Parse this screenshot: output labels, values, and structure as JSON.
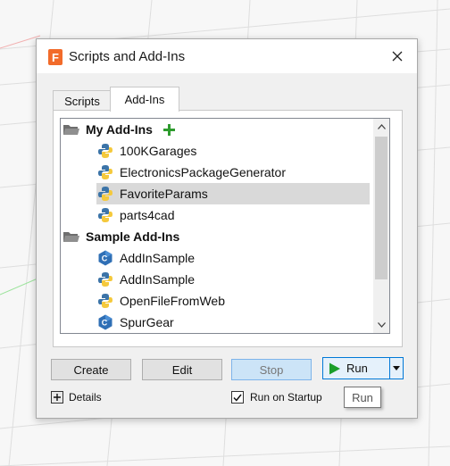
{
  "window": {
    "title": "Scripts and Add-Ins",
    "app_icon_letter": "F"
  },
  "tabs": [
    {
      "label": "Scripts",
      "active": false
    },
    {
      "label": "Add-Ins",
      "active": true
    }
  ],
  "list": {
    "groups": [
      {
        "label": "My Add-Ins",
        "items": [
          {
            "label": "100KGarages",
            "icon": "python-icon"
          },
          {
            "label": "ElectronicsPackageGenerator",
            "icon": "python-icon"
          },
          {
            "label": "FavoriteParams",
            "icon": "python-icon",
            "selected": true
          },
          {
            "label": "parts4cad",
            "icon": "python-icon"
          }
        ]
      },
      {
        "label": "Sample Add-Ins",
        "items": [
          {
            "label": "AddInSample",
            "icon": "cpp-icon"
          },
          {
            "label": "AddInSample",
            "icon": "python-icon"
          },
          {
            "label": "OpenFileFromWeb",
            "icon": "python-icon"
          },
          {
            "label": "SpurGear",
            "icon": "cpp-icon"
          }
        ]
      }
    ]
  },
  "buttons": {
    "create": "Create",
    "edit": "Edit",
    "stop": "Stop",
    "run": "Run"
  },
  "details_label": "Details",
  "run_on_startup": {
    "label": "Run on Startup",
    "checked": true
  },
  "tooltip": "Run",
  "colors": {
    "accent": "#0078d7",
    "run_green": "#1a9e2a",
    "add_green": "#2e9b2e",
    "selection": "#d9d9d9"
  }
}
